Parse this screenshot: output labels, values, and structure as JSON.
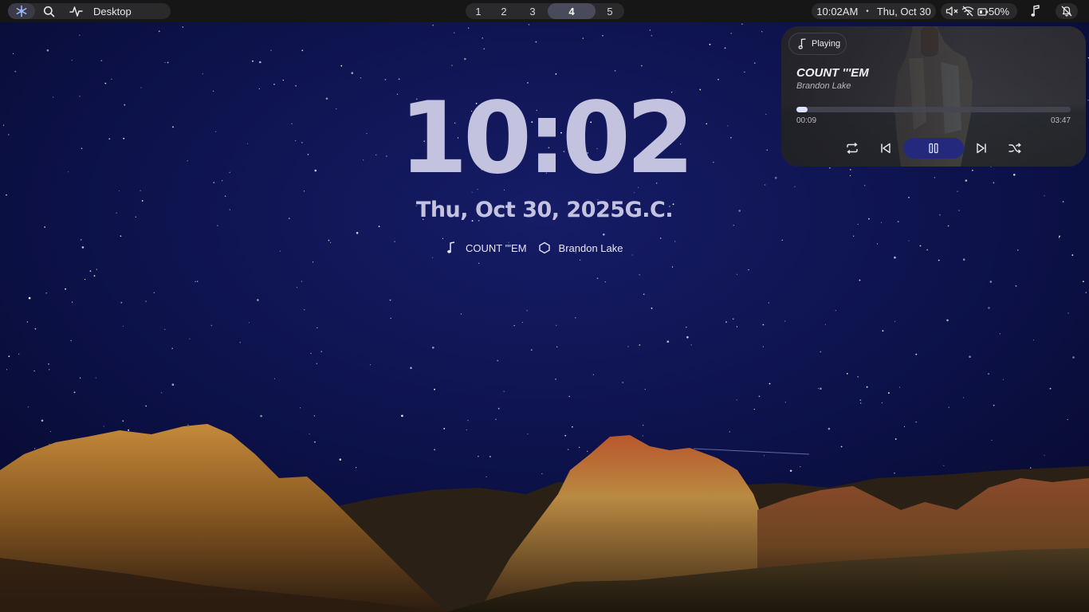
{
  "topbar": {
    "left": {
      "logo_icon": "arch-snowflake-icon",
      "search_icon": "search-icon",
      "activity_icon": "activity-icon",
      "desktop_label": "Desktop"
    },
    "workspaces": [
      {
        "label": "1",
        "active": false
      },
      {
        "label": "2",
        "active": false
      },
      {
        "label": "3",
        "active": false
      },
      {
        "label": "4",
        "active": true
      },
      {
        "label": "5",
        "active": false
      }
    ],
    "clock": {
      "time": "10:02AM",
      "separator": "•",
      "date": "Thu, Oct 30"
    },
    "status": {
      "volume_icon": "volume-muted-icon",
      "wifi_icon": "wifi-off-icon",
      "battery_icon": "battery-icon",
      "battery_percent": "50%"
    },
    "media_icon": "music-note-icon",
    "notifications_icon": "bell-off-icon"
  },
  "desktop": {
    "clock": "10:02",
    "date": "Thu, Oct 30, 2025G.C.",
    "now_playing": {
      "title": "COUNT '''EM",
      "artist": "Brandon Lake"
    }
  },
  "media_player": {
    "status_chip": "Playing",
    "title": "COUNT '''EM",
    "artist": "Brandon Lake",
    "elapsed": "00:09",
    "total": "03:47",
    "progress": 0.04,
    "controls": [
      "repeat-icon",
      "previous-icon",
      "pause-icon",
      "next-icon",
      "shuffle-icon"
    ],
    "accent_color": "#24297d"
  },
  "colors": {
    "bar_bg": "#161617",
    "pill_bg": "#2a2a2c",
    "clock_text": "#c3c3e0",
    "sky": "#0b0f3f"
  }
}
